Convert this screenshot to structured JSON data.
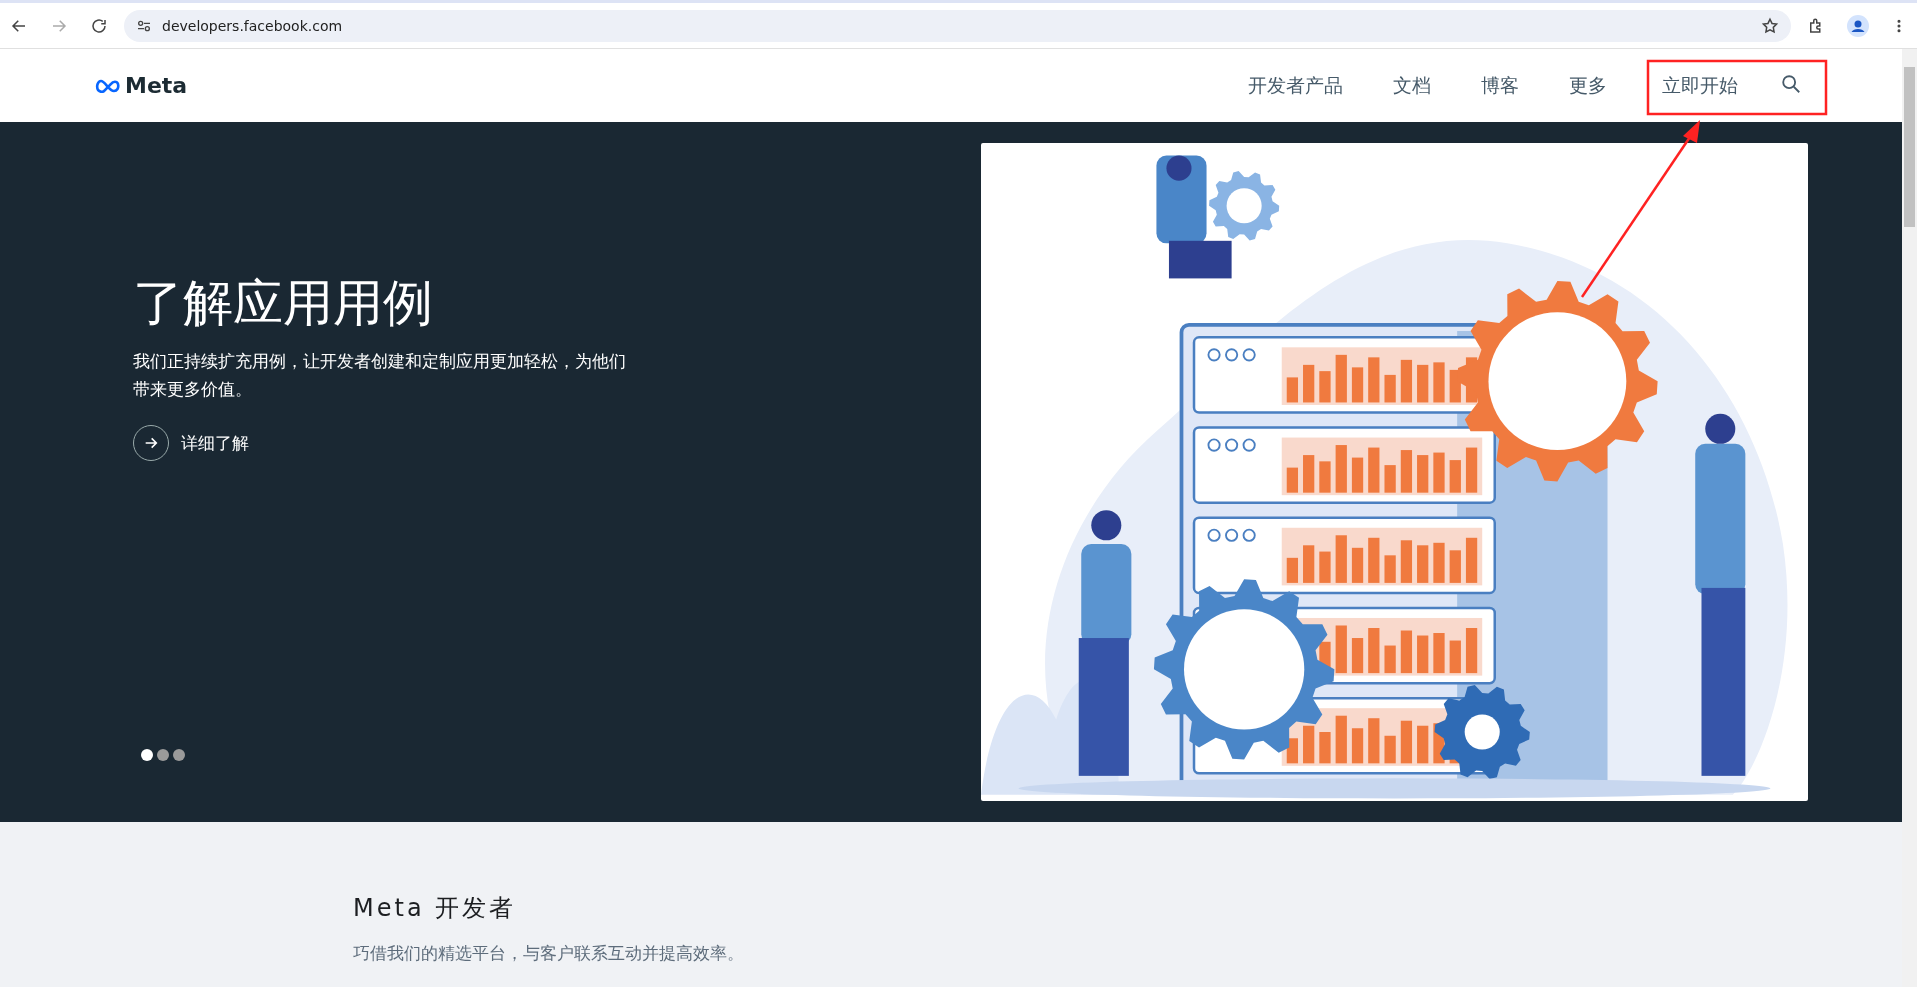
{
  "browser": {
    "url": "developers.facebook.com"
  },
  "nav": {
    "logo": "Meta",
    "items": [
      {
        "label": "开发者产品"
      },
      {
        "label": "文档"
      },
      {
        "label": "博客"
      },
      {
        "label": "更多"
      }
    ],
    "cta": "立即开始"
  },
  "hero": {
    "title": "了解应用用例",
    "description": "我们正持续扩充用例，让开发者创建和定制应用更加轻松，为他们带来更多价值。",
    "link": "详细了解",
    "slides": [
      {
        "selected": true
      },
      {
        "selected": false
      },
      {
        "selected": false
      }
    ]
  },
  "section": {
    "title": "Meta 开发者",
    "subtitle": "巧借我们的精选平台，与客户联系互动并提高效率。"
  }
}
